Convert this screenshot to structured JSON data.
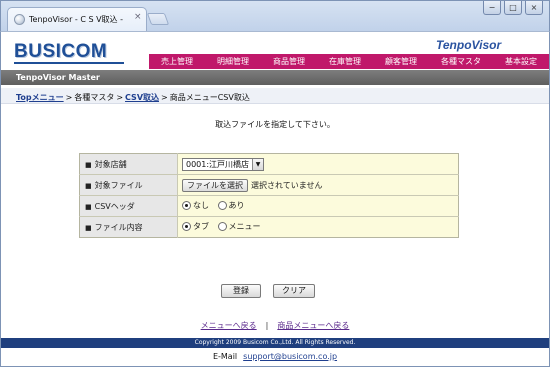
{
  "browser": {
    "tab_title": "TenpoVisor - C S V取込 -",
    "tab_close": "×",
    "window_buttons": [
      "−",
      "□",
      "×"
    ]
  },
  "header": {
    "logo": "BUSICOM",
    "brand": "TenpoVisor",
    "nav": [
      "売上管理",
      "明細管理",
      "商品管理",
      "在庫管理",
      "顧客管理",
      "各種マスタ",
      "基本設定"
    ],
    "master_label": "TenpoVisor Master"
  },
  "breadcrumb": {
    "items": [
      "Topメニュー",
      "各種マスタ",
      "CSV取込",
      "商品メニューCSV取込"
    ],
    "separator": ">"
  },
  "main": {
    "instruction": "取込ファイルを指定して下さい。",
    "form": {
      "store_label": "対象店舗",
      "store_value": "0001:江戸川橋店",
      "file_label": "対象ファイル",
      "file_button": "ファイルを選択",
      "file_status": "選択されていません",
      "header_label": "CSVヘッダ",
      "header_options": [
        "なし",
        "あり"
      ],
      "content_label": "ファイル内容",
      "content_options": [
        "タブ",
        "メニュー"
      ],
      "bullet": "■"
    },
    "buttons": {
      "register": "登録",
      "clear": "クリア"
    }
  },
  "footer": {
    "link_menu": "メニューへ戻る",
    "link_separator": "|",
    "link_product_menu": "商品メニューへ戻る",
    "copyright": "Copyright 2009 Busicom Co.,Ltd. All Rights Reserved.",
    "email_label": "E-Mail",
    "email": "support@busicom.co.jp"
  },
  "colors": {
    "nav_bg": "#c0186a",
    "logo": "#1f4f97",
    "footer_bg": "#1f3f7e",
    "form_value_bg": "#fcfbdc"
  }
}
